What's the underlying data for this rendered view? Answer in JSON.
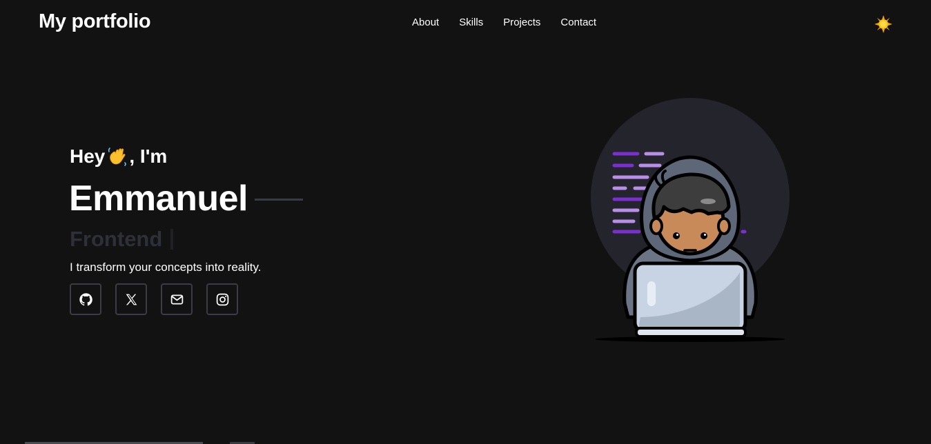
{
  "header": {
    "brand": "My portfolio",
    "nav": [
      {
        "label": "About"
      },
      {
        "label": "Skills"
      },
      {
        "label": "Projects"
      },
      {
        "label": "Contact"
      }
    ],
    "theme_toggle_icon": "sun-icon"
  },
  "hero": {
    "greeting_prefix": "Hey",
    "greeting_suffix": ", I'm",
    "greeting_icon": "waving-hand-icon",
    "name": "Emmanuel",
    "role": "Frontend",
    "tagline": "I transform your concepts into reality.",
    "socials": [
      {
        "icon": "github-icon"
      },
      {
        "icon": "x-twitter-icon"
      },
      {
        "icon": "mail-icon"
      },
      {
        "icon": "instagram-icon"
      }
    ],
    "illustration": "developer-with-laptop-illustration"
  },
  "colors": {
    "background": "#121212",
    "text": "#ffffff",
    "muted_role": "#2f2f39",
    "border": "#3c3c46",
    "circle": "#24242c",
    "code_purple": "#7b2fd0",
    "code_lavender": "#b98ee8",
    "sun": "#f5c518"
  }
}
